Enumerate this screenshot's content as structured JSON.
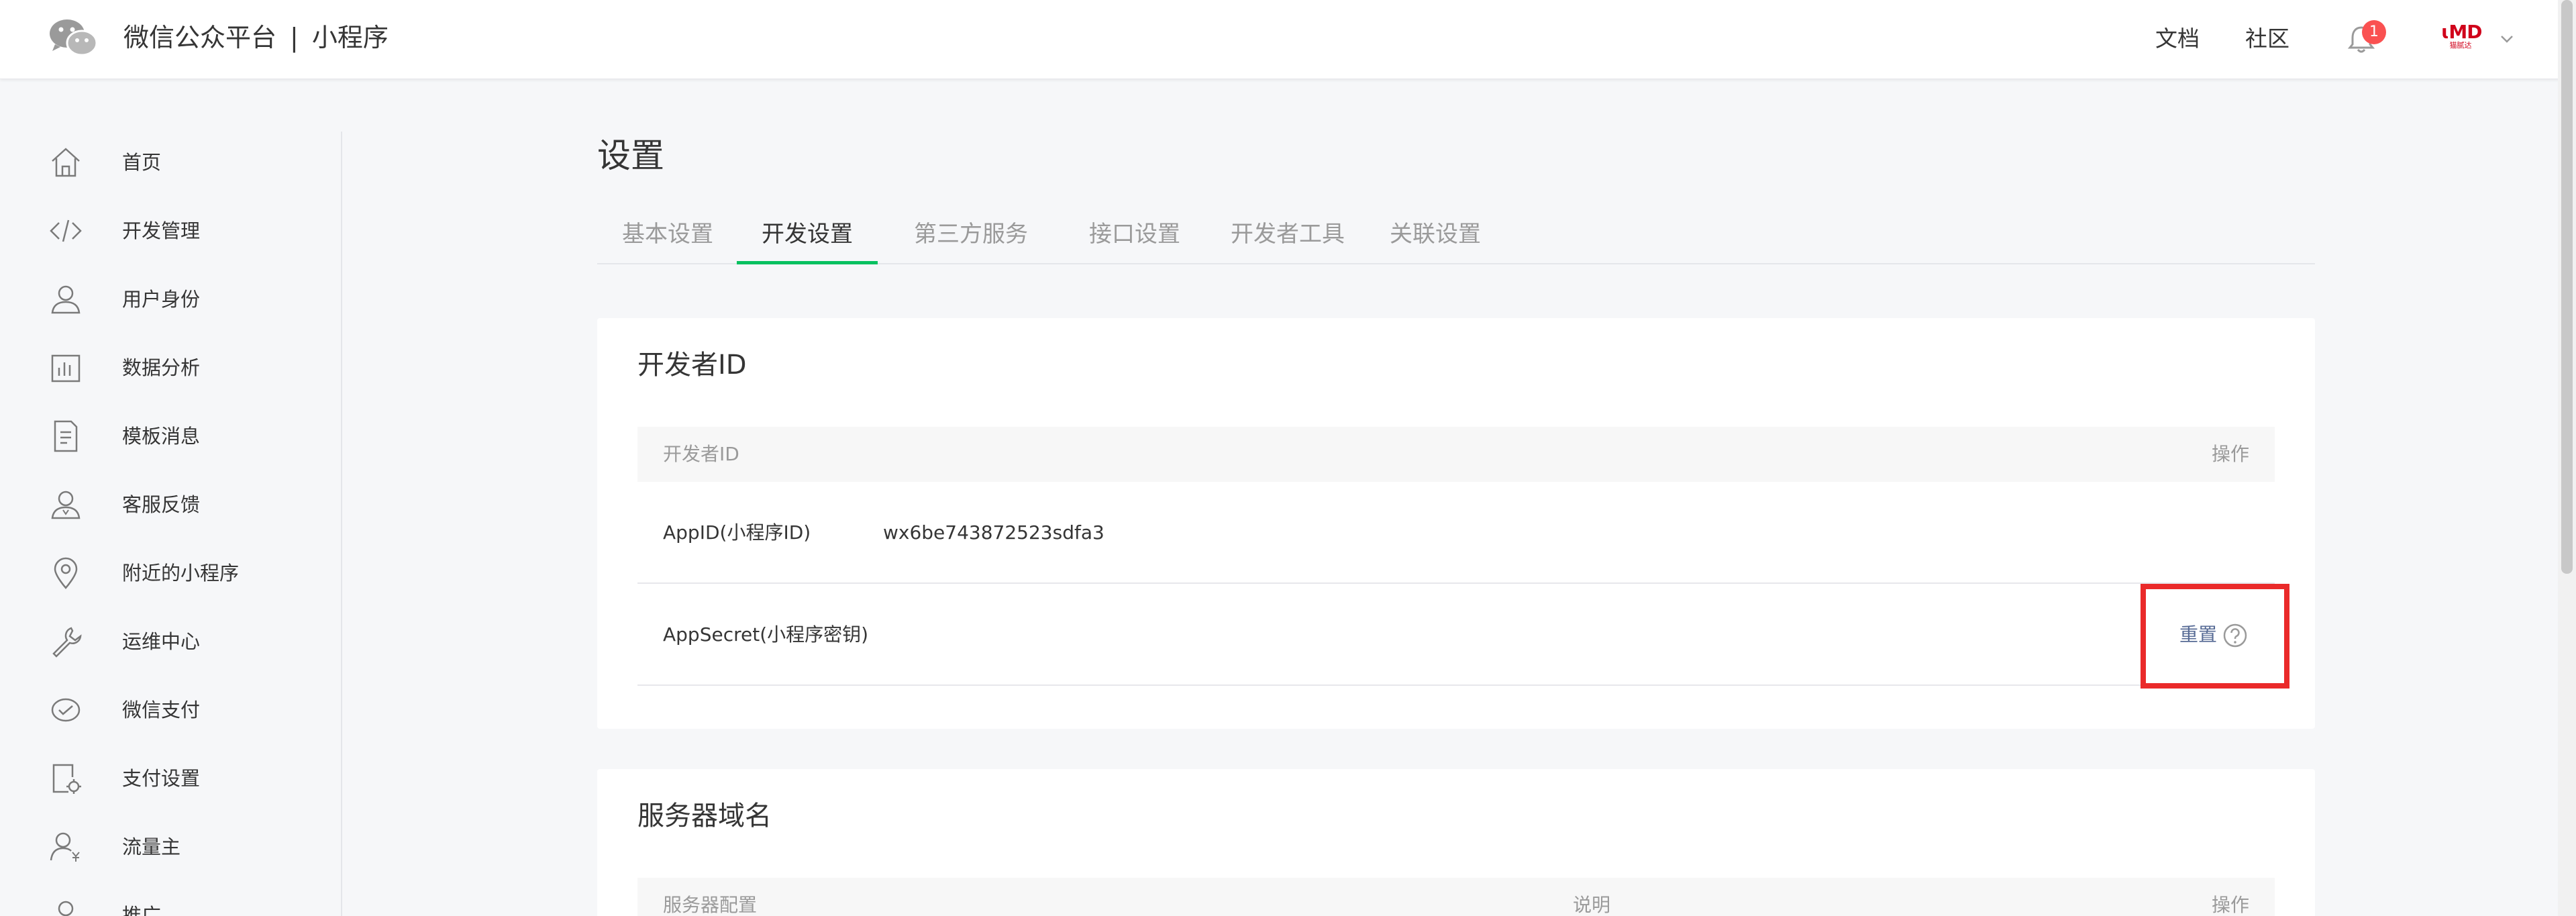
{
  "header": {
    "brand_main": "微信公众平台",
    "brand_sep": "|",
    "brand_sub": "小程序",
    "links": {
      "docs": "文档",
      "community": "社区"
    },
    "notification_count": "1",
    "avatar_logo": "ɩMD",
    "avatar_sub": "猫腻达"
  },
  "sidebar": {
    "items": [
      {
        "label": "首页",
        "icon": "home-icon"
      },
      {
        "label": "开发管理",
        "icon": "code-icon"
      },
      {
        "label": "用户身份",
        "icon": "user-icon"
      },
      {
        "label": "数据分析",
        "icon": "bar-chart-icon"
      },
      {
        "label": "模板消息",
        "icon": "document-icon"
      },
      {
        "label": "客服反馈",
        "icon": "service-user-icon"
      },
      {
        "label": "附近的小程序",
        "icon": "location-pin-icon"
      },
      {
        "label": "运维中心",
        "icon": "wrench-icon"
      },
      {
        "label": "微信支付",
        "icon": "wechat-pay-icon"
      },
      {
        "label": "支付设置",
        "icon": "payment-settings-icon"
      },
      {
        "label": "流量主",
        "icon": "traffic-user-icon"
      },
      {
        "label": "推广",
        "icon": "promote-icon"
      }
    ]
  },
  "main": {
    "title": "设置",
    "tabs": [
      {
        "label": "基本设置",
        "active": false
      },
      {
        "label": "开发设置",
        "active": true
      },
      {
        "label": "第三方服务",
        "active": false
      },
      {
        "label": "接口设置",
        "active": false
      },
      {
        "label": "开发者工具",
        "active": false
      },
      {
        "label": "关联设置",
        "active": false
      }
    ],
    "developer_card": {
      "title": "开发者ID",
      "head": {
        "col1": "开发者ID",
        "col_action": "操作"
      },
      "rows": [
        {
          "name": "AppID(小程序ID)",
          "value": "wx6be743872523sdfa3",
          "action": ""
        },
        {
          "name": "AppSecret(小程序密钥)",
          "value": "",
          "action": "重置"
        }
      ]
    },
    "server_card": {
      "title": "服务器域名",
      "head": {
        "col1": "服务器配置",
        "col2": "说明",
        "col_action": "操作"
      }
    }
  },
  "colors": {
    "accent": "#07c160",
    "link": "#576b95",
    "highlight": "#ea2a2a",
    "badge": "#fa5151"
  }
}
